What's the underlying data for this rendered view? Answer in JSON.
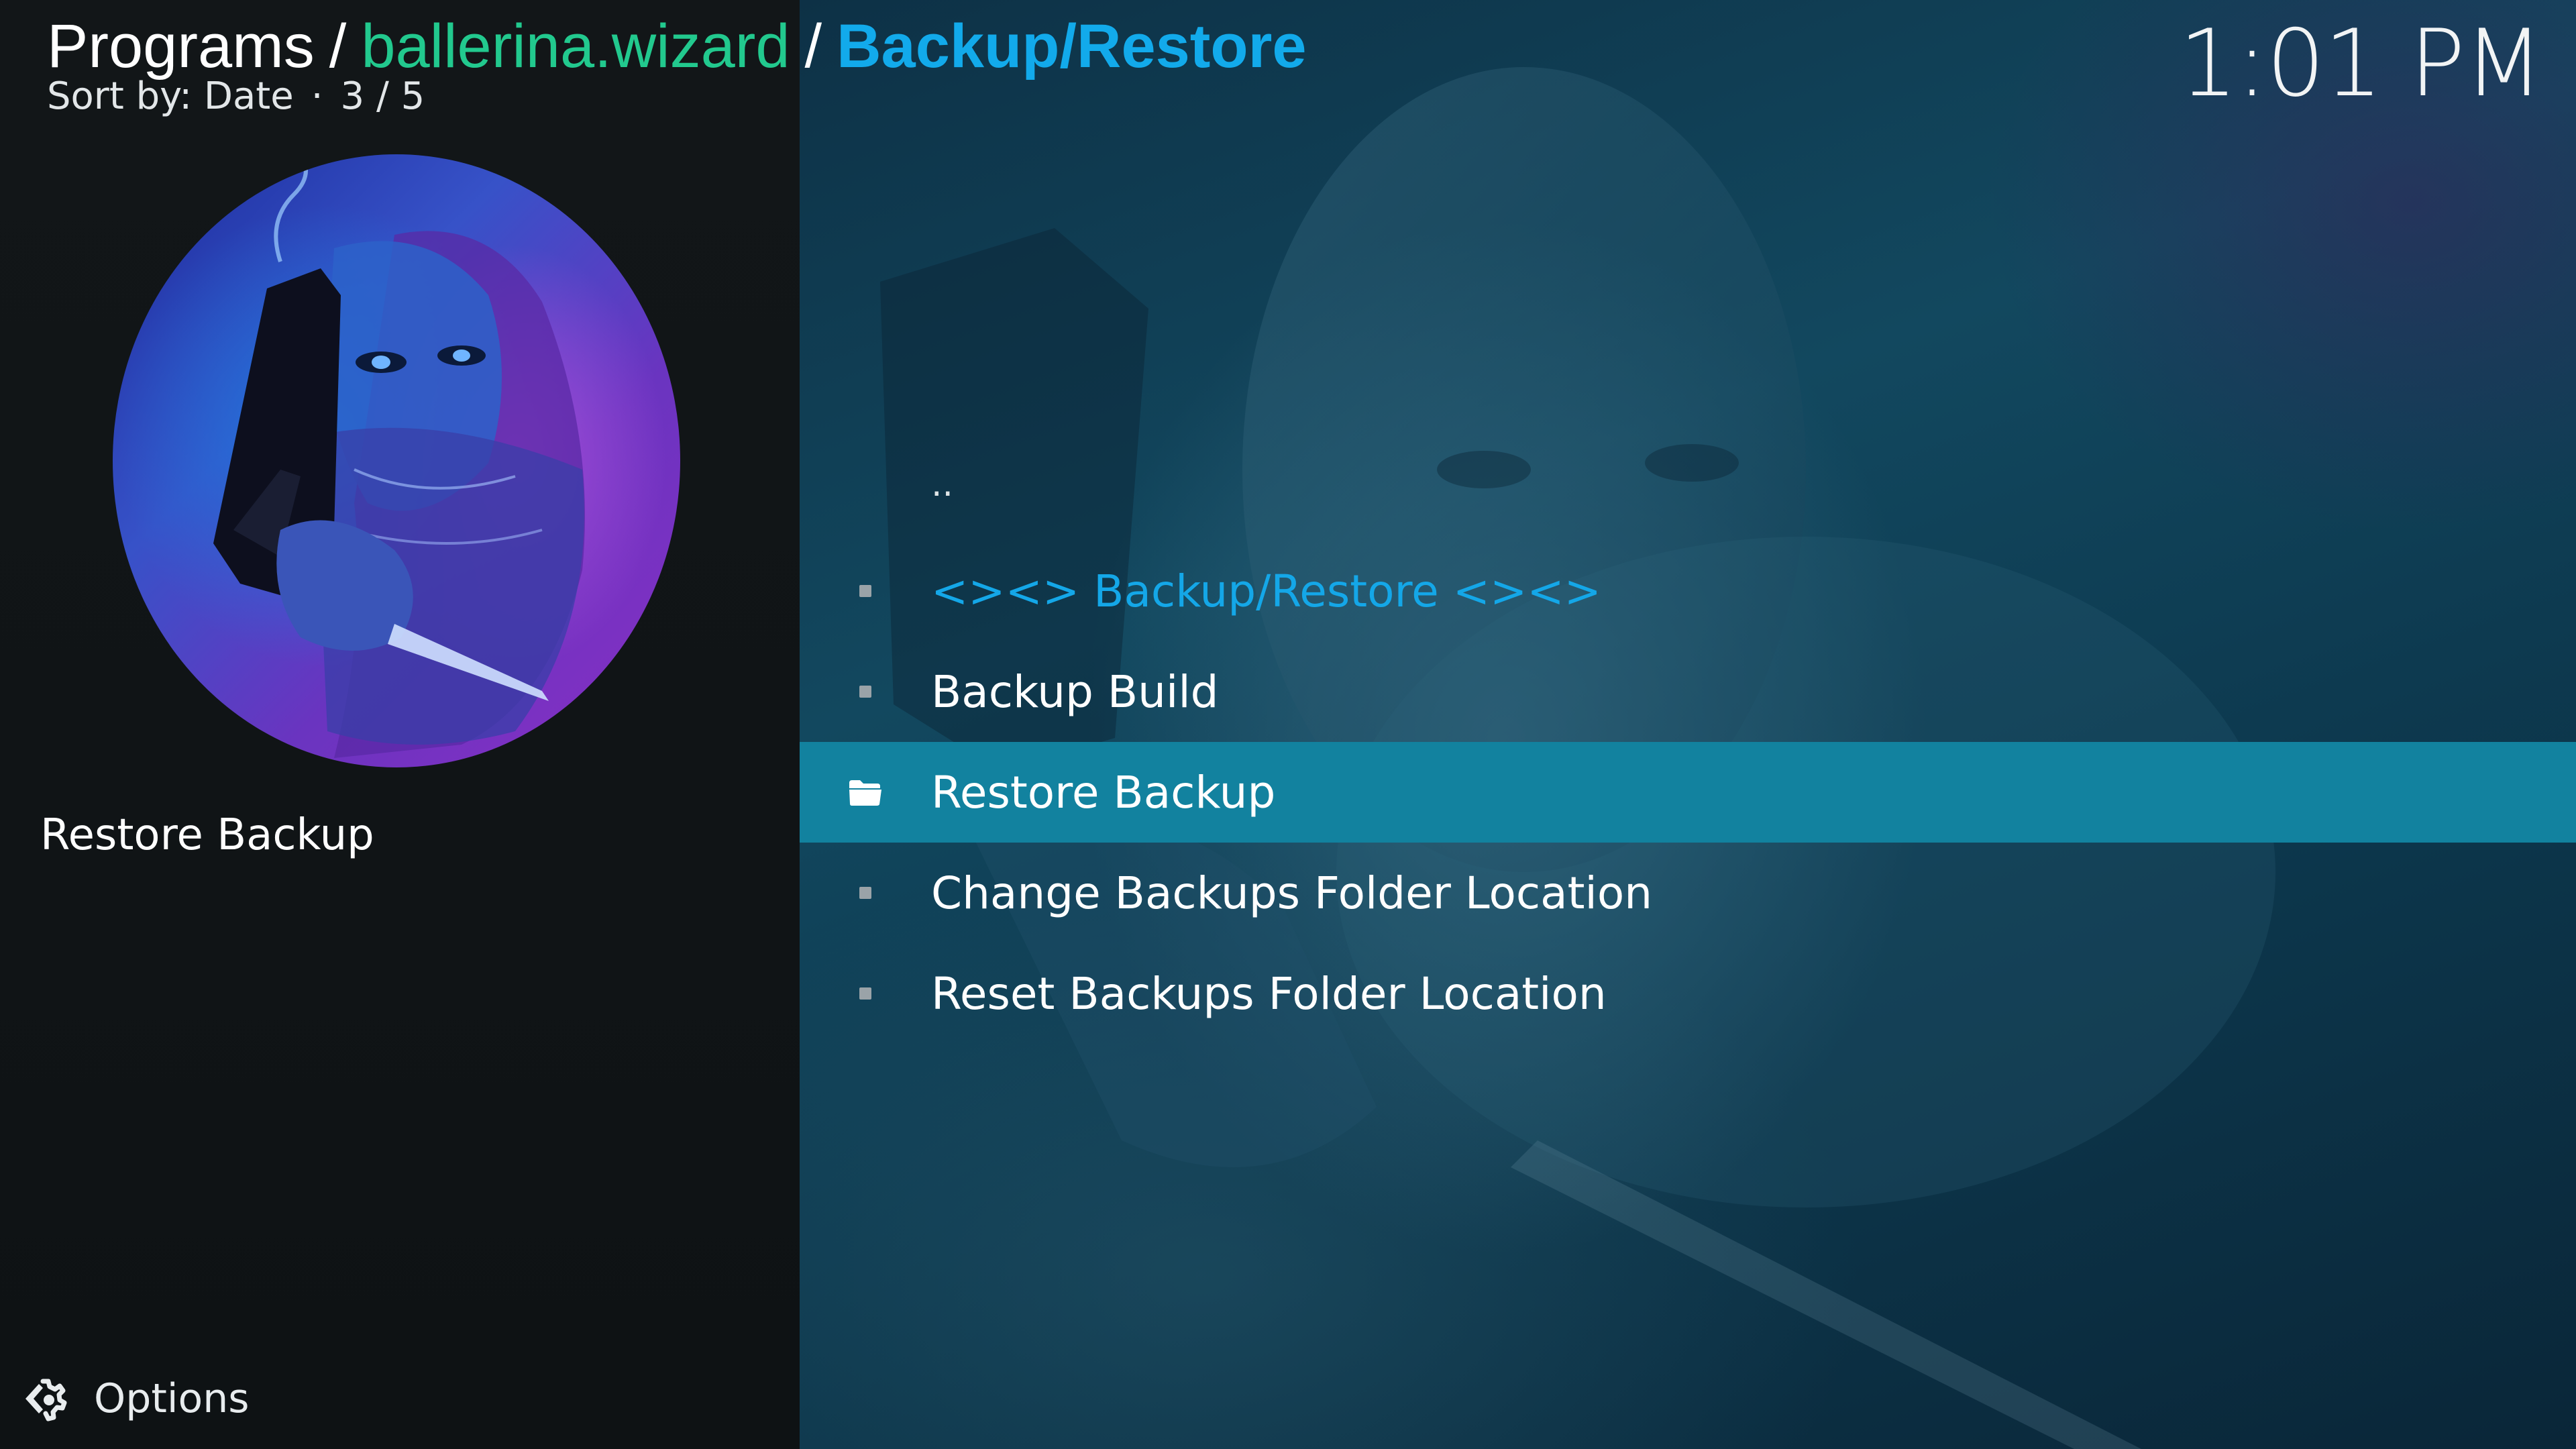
{
  "header": {
    "breadcrumb": {
      "root": "Programs",
      "separator": "/",
      "addon": "ballerina.wizard",
      "current": "Backup/Restore"
    },
    "sort_label": "Sort by: Date",
    "sort_separator": "·",
    "position": "3 / 5",
    "clock": "1:01 PM"
  },
  "sidebar": {
    "thumbnail_icon": "addon-artwork",
    "item_title": "Restore Backup"
  },
  "list": {
    "items": [
      {
        "label": "..",
        "kind": "parent-folder"
      },
      {
        "label": "<><> Backup/Restore <><>",
        "kind": "header",
        "icon": "bullet-icon"
      },
      {
        "label": "Backup Build",
        "kind": "item",
        "icon": "bullet-icon"
      },
      {
        "label": "Restore Backup",
        "kind": "item",
        "icon": "folder-icon",
        "focused": true
      },
      {
        "label": "Change Backups Folder Location",
        "kind": "item",
        "icon": "bullet-icon"
      },
      {
        "label": "Reset Backups Folder Location",
        "kind": "item",
        "icon": "bullet-icon"
      }
    ]
  },
  "footer": {
    "options_label": "Options",
    "options_icon": "options-gear-icon"
  },
  "colors": {
    "accent_blue": "#12aaeb",
    "addon_green": "#22c98e",
    "focus_bar": "#12829f"
  }
}
